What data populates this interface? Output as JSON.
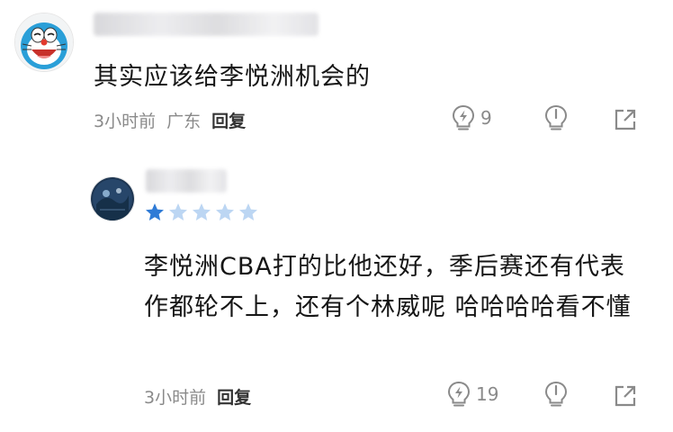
{
  "comments": [
    {
      "avatar": "doraemon-avatar",
      "text": "其实应该给李悦洲机会的",
      "time": "3小时前",
      "location": "广东",
      "reply_label": "回复",
      "likes": "9"
    },
    {
      "avatar": "dark-blue-avatar",
      "rating": 1,
      "rating_max": 5,
      "text": "李悦洲CBA打的比他还好，季后赛还有代表作都轮不上，还有个林威呢 哈哈哈哈看不懂",
      "time": "3小时前",
      "reply_label": "回复",
      "likes": "19"
    }
  ],
  "colors": {
    "star_filled": "#2f7bd6",
    "star_empty": "#bcd6f3",
    "meta_text": "#8a8a8a"
  },
  "icons": [
    "like-icon",
    "lightbulb-icon",
    "share-icon"
  ]
}
